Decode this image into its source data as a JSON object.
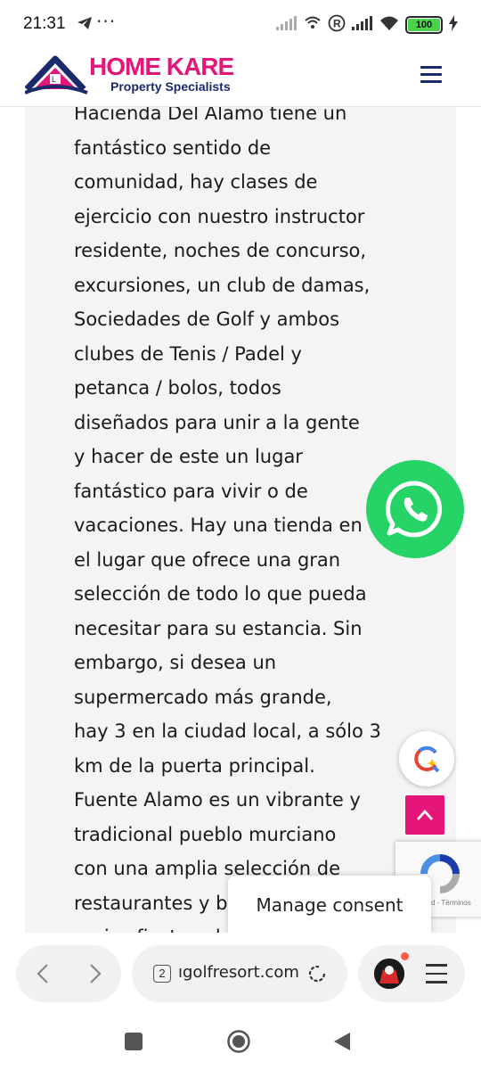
{
  "status_bar": {
    "time": "21:31",
    "more": "···",
    "battery": "100",
    "colors": {
      "battery_fill": "#4bd34b"
    }
  },
  "header": {
    "brand_title": "HOME KARE",
    "brand_subtitle": "Property Specialists",
    "logo_mark_text": "L",
    "colors": {
      "brand": "#e6157a",
      "navy": "#1b2a6a"
    }
  },
  "article": {
    "lines": [
      "Hacienda Del Alamo tiene un",
      "fantástico sentido de",
      "comunidad, hay clases de",
      "ejercicio con nuestro instructor",
      "residente, noches de concurso,",
      "excursiones, un club de damas,",
      "Sociedades de Golf y ambos",
      "clubes de Tenis / Padel y",
      "petanca / bolos, todos",
      "diseñados para unir a la gente",
      "y hacer de este un lugar",
      "fantástico para vivir o de",
      "vacaciones. Hay una tienda en",
      "el lugar que ofrece una gran",
      "selección de todo lo que pueda",
      "necesitar para su estancia. Sin",
      "embargo, si desea un",
      "supermercado más grande,",
      "hay 3 en la ciudad local, a sólo 3",
      "km de la puerta principal.",
      "Fuente Alamo es un vibrante y",
      "tradicional pueblo murciano",
      "con una amplia selección de",
      "restaurantes y bares y",
      "varias fiestas al año."
    ]
  },
  "floating": {
    "whatsapp_icon": "whatsapp-icon",
    "back_to_top_icon": "chevron-up-icon",
    "recaptcha_text": "d - Términos",
    "manage_consent": "Manage consent",
    "colors": {
      "whatsapp": "#25d366",
      "back_to_top": "#e6157a"
    }
  },
  "browser": {
    "tab_count": "2",
    "url": "ıgolfresort.com"
  }
}
